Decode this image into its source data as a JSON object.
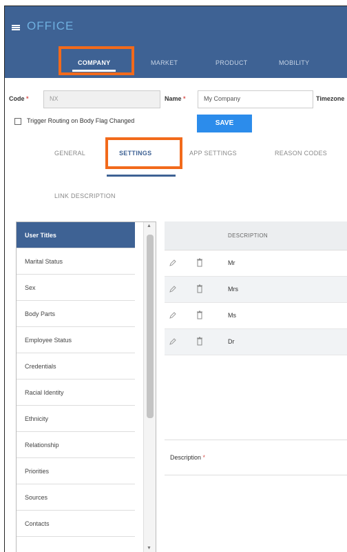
{
  "app": {
    "brand": "OFFICE"
  },
  "nav": {
    "tabs": [
      {
        "label": "COMPANY",
        "active": true
      },
      {
        "label": "MARKET"
      },
      {
        "label": "PRODUCT"
      },
      {
        "label": "MOBILITY"
      }
    ]
  },
  "form": {
    "code_label": "Code",
    "code_value": "NX",
    "name_label": "Name",
    "name_value": "My Company",
    "timezone_label": "Timezone",
    "required_mark": "*",
    "checkbox_label": "Trigger Routing on Body Flag Changed",
    "save_label": "SAVE"
  },
  "subtabs": {
    "items": [
      {
        "label": "GENERAL"
      },
      {
        "label": "SETTINGS",
        "active": true
      },
      {
        "label": "APP SETTINGS"
      },
      {
        "label": "REASON CODES"
      }
    ],
    "second_row": "LINK DESCRIPTION"
  },
  "sidebar": {
    "items": [
      {
        "label": "User Titles",
        "active": true
      },
      {
        "label": "Marital Status"
      },
      {
        "label": "Sex"
      },
      {
        "label": "Body Parts"
      },
      {
        "label": "Employee Status"
      },
      {
        "label": "Credentials"
      },
      {
        "label": "Racial Identity"
      },
      {
        "label": "Ethnicity"
      },
      {
        "label": "Relationship"
      },
      {
        "label": "Priorities"
      },
      {
        "label": "Sources"
      },
      {
        "label": "Contacts"
      }
    ]
  },
  "grid": {
    "header": "DESCRIPTION",
    "rows": [
      "Mr",
      "Mrs",
      "Ms",
      "Dr"
    ]
  },
  "description_form": {
    "label": "Description",
    "required_mark": "*"
  },
  "colors": {
    "primary": "#3e6294",
    "accent": "#2c8ceb",
    "highlight": "#f26a1b"
  }
}
